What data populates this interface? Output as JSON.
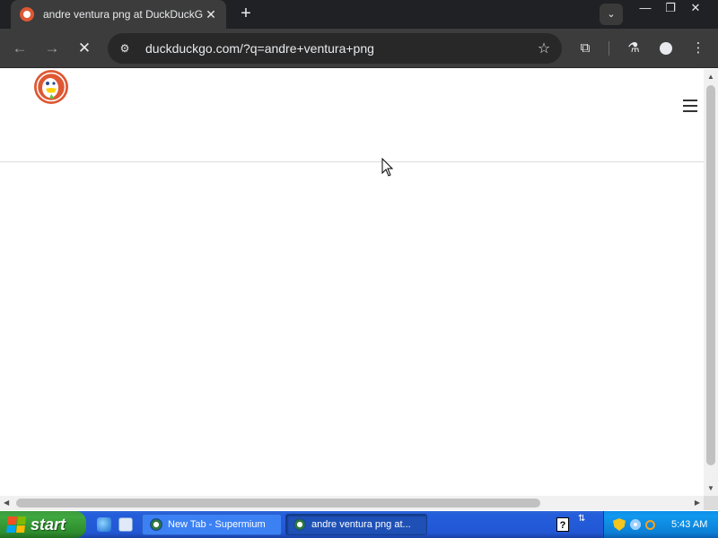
{
  "browser": {
    "tab": {
      "title": "andre ventura png at DuckDuckGo",
      "favicon": "duckduckgo-favicon",
      "close_glyph": "✕"
    },
    "new_tab_glyph": "+",
    "tab_search_glyph": "⌄",
    "window_controls": {
      "minimize": "—",
      "maximize": "❐",
      "close": "✕"
    },
    "toolbar": {
      "back_glyph": "←",
      "forward_glyph": "→",
      "stop_glyph": "✕",
      "site_info_glyph": "⚙",
      "url": "duckduckgo.com/?q=andre+ventura+png",
      "bookmark_glyph": "☆",
      "extensions_glyph": "⧉",
      "labs_glyph": "⚗",
      "menu_glyph": "⋮"
    }
  },
  "page": {
    "logo": "duckduckgo-logo",
    "menu_icon": "hamburger-menu-icon",
    "background": "#ffffff",
    "divider_color": "#dcdcdc"
  },
  "scrollbars": {
    "up": "▲",
    "down": "▼",
    "left": "◀",
    "right": "▶"
  },
  "taskbar": {
    "start_label": "start",
    "quick_launch": [
      "internet-explorer-icon",
      "show-desktop-icon"
    ],
    "items": [
      {
        "label": "New Tab - Supermium",
        "active": false
      },
      {
        "label": "andre ventura png at...",
        "active": true
      }
    ],
    "help_glyph": "?",
    "language_glyph": "⇅",
    "tray_icons": [
      "security-shield-icon",
      "network-icon",
      "search-tray-icon"
    ],
    "clock": "5:43 AM"
  },
  "colors": {
    "tabstrip": "#202124",
    "toolbar": "#3c3c3c",
    "omnibox": "#282828",
    "ddg_orange": "#de5833",
    "taskbar_blue": "#245edb",
    "start_green": "#3fa83f",
    "tray_blue": "#1098ee"
  }
}
